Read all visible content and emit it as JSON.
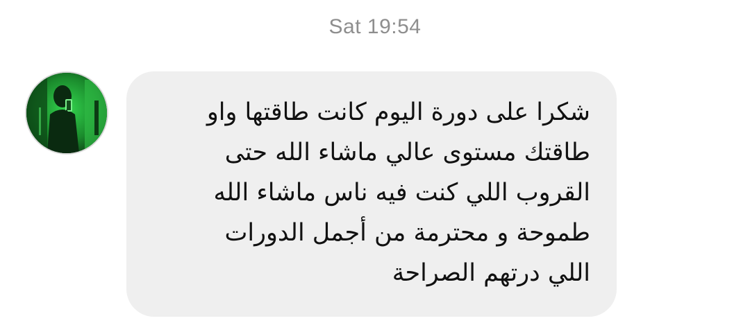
{
  "conversation": {
    "timestamp": "Sat 19:54",
    "messages": [
      {
        "sender_avatar": "avatar-photo-green-tint",
        "text": "شكرا على دورة اليوم كانت طاقتها واو\nطاقتك مستوى عالي ماشاء الله حتى\nالقروب اللي كنت فيه ناس ماشاء الله\nطموحة و محترمة من أجمل الدورات\nاللي درتهم الصراحة",
        "bubble_color": "#efefef"
      }
    ]
  },
  "colors": {
    "background": "#ffffff",
    "timestamp": "#8e8e8e",
    "text": "#111111",
    "avatar_tint": "#1fbf3a"
  }
}
